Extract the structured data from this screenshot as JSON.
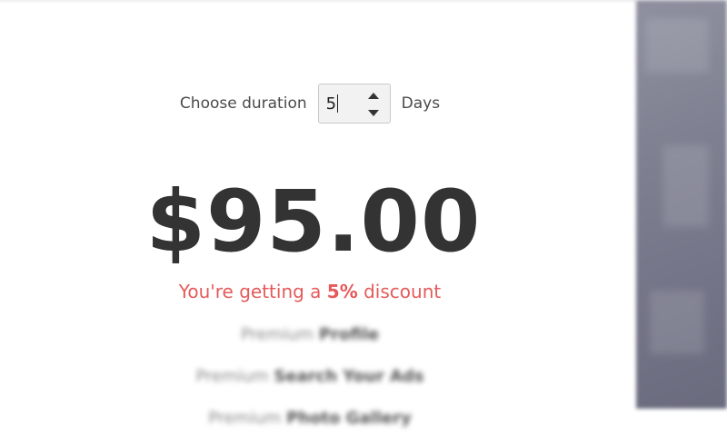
{
  "duration": {
    "label": "Choose duration",
    "value": "5",
    "unit": "Days"
  },
  "price": "$95.00",
  "discount": {
    "prefix": "You're getting a ",
    "percent": "5%",
    "suffix": " discount"
  },
  "features": [
    {
      "prefix": "Premium ",
      "strong": "Profile"
    },
    {
      "prefix": "Premium ",
      "strong": "Search Your Ads"
    },
    {
      "prefix": "Premium ",
      "strong": "Photo Gallery"
    }
  ],
  "colors": {
    "discount": "#e65a5a",
    "price": "#333333"
  },
  "icons": {
    "spin_up": "chevron-up-icon",
    "spin_down": "chevron-down-icon"
  }
}
